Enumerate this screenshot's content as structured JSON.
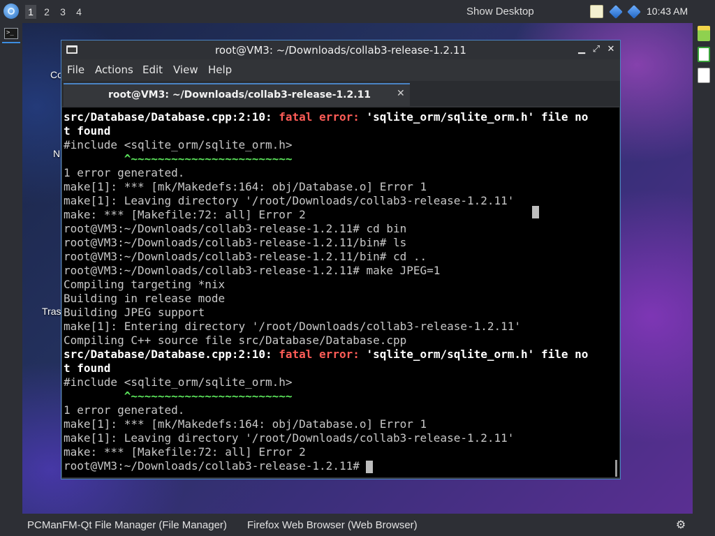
{
  "top_panel": {
    "workspaces": [
      "1",
      "2",
      "3",
      "4"
    ],
    "active_workspace": "1",
    "show_desktop": "Show Desktop",
    "clock": "10:43 AM"
  },
  "desktop": {
    "icon_labels": [
      "Co",
      "N",
      "Tras"
    ]
  },
  "window": {
    "title": "root@VM3: ~/Downloads/collab3-release-1.2.11",
    "menu": [
      "File",
      "Actions",
      "Edit",
      "View",
      "Help"
    ],
    "tab_title": "root@VM3: ~/Downloads/collab3-release-1.2.11"
  },
  "terminal_lines": [
    {
      "segments": [
        {
          "t": "src/Database/Database.cpp:2:10: ",
          "c": "b"
        },
        {
          "t": "fatal error: ",
          "c": "err"
        },
        {
          "t": "'sqlite_orm/sqlite_orm.h' file no",
          "c": "b"
        }
      ]
    },
    {
      "segments": [
        {
          "t": "t found",
          "c": "b"
        }
      ]
    },
    {
      "segments": [
        {
          "t": "#include <sqlite_orm/sqlite_orm.h>",
          "c": ""
        }
      ]
    },
    {
      "segments": [
        {
          "t": "         ^~~~~~~~~~~~~~~~~~~~~~~~~",
          "c": "grn"
        }
      ]
    },
    {
      "segments": [
        {
          "t": "1 error generated.",
          "c": ""
        }
      ]
    },
    {
      "segments": [
        {
          "t": "make[1]: *** [mk/Makedefs:164: obj/Database.o] Error 1",
          "c": ""
        }
      ]
    },
    {
      "segments": [
        {
          "t": "make[1]: Leaving directory '/root/Downloads/collab3-release-1.2.11'",
          "c": ""
        }
      ]
    },
    {
      "segments": [
        {
          "t": "make: *** [Makefile:72: all] Error 2",
          "c": ""
        }
      ]
    },
    {
      "segments": [
        {
          "t": "root@VM3:~/Downloads/collab3-release-1.2.11# cd bin",
          "c": ""
        }
      ]
    },
    {
      "segments": [
        {
          "t": "root@VM3:~/Downloads/collab3-release-1.2.11/bin# ls",
          "c": ""
        }
      ]
    },
    {
      "segments": [
        {
          "t": "root@VM3:~/Downloads/collab3-release-1.2.11/bin# cd ..",
          "c": ""
        }
      ]
    },
    {
      "segments": [
        {
          "t": "root@VM3:~/Downloads/collab3-release-1.2.11# make JPEG=1",
          "c": ""
        }
      ]
    },
    {
      "segments": [
        {
          "t": "Compiling targeting *nix",
          "c": ""
        }
      ]
    },
    {
      "segments": [
        {
          "t": "Building in release mode",
          "c": ""
        }
      ]
    },
    {
      "segments": [
        {
          "t": "Building JPEG support",
          "c": ""
        }
      ]
    },
    {
      "segments": [
        {
          "t": "make[1]: Entering directory '/root/Downloads/collab3-release-1.2.11'",
          "c": ""
        }
      ]
    },
    {
      "segments": [
        {
          "t": "Compiling C++ source file src/Database/Database.cpp",
          "c": ""
        }
      ]
    },
    {
      "segments": [
        {
          "t": "src/Database/Database.cpp:2:10: ",
          "c": "b"
        },
        {
          "t": "fatal error: ",
          "c": "err"
        },
        {
          "t": "'sqlite_orm/sqlite_orm.h' file no",
          "c": "b"
        }
      ]
    },
    {
      "segments": [
        {
          "t": "t found",
          "c": "b"
        }
      ]
    },
    {
      "segments": [
        {
          "t": "#include <sqlite_orm/sqlite_orm.h>",
          "c": ""
        }
      ]
    },
    {
      "segments": [
        {
          "t": "         ^~~~~~~~~~~~~~~~~~~~~~~~~",
          "c": "grn"
        }
      ]
    },
    {
      "segments": [
        {
          "t": "1 error generated.",
          "c": ""
        }
      ]
    },
    {
      "segments": [
        {
          "t": "make[1]: *** [mk/Makedefs:164: obj/Database.o] Error 1",
          "c": ""
        }
      ]
    },
    {
      "segments": [
        {
          "t": "make[1]: Leaving directory '/root/Downloads/collab3-release-1.2.11'",
          "c": ""
        }
      ]
    },
    {
      "segments": [
        {
          "t": "make: *** [Makefile:72: all] Error 2",
          "c": ""
        }
      ]
    },
    {
      "segments": [
        {
          "t": "root@VM3:~/Downloads/collab3-release-1.2.11# ",
          "c": ""
        }
      ],
      "cursor": true
    }
  ],
  "taskbar": {
    "tasks": [
      "PCManFM-Qt File Manager (File Manager)",
      "Firefox Web Browser (Web Browser)"
    ]
  },
  "colors": {
    "accent": "#4a84c4",
    "error": "#ff5c57",
    "caret": "#5ce65c"
  },
  "icons": {
    "menu": "start-menu-icon",
    "tray": [
      "clipboard-icon",
      "network-icon",
      "bluetooth-icon"
    ],
    "window": "terminal-icon",
    "bottom_right": "settings-gear-icon"
  }
}
